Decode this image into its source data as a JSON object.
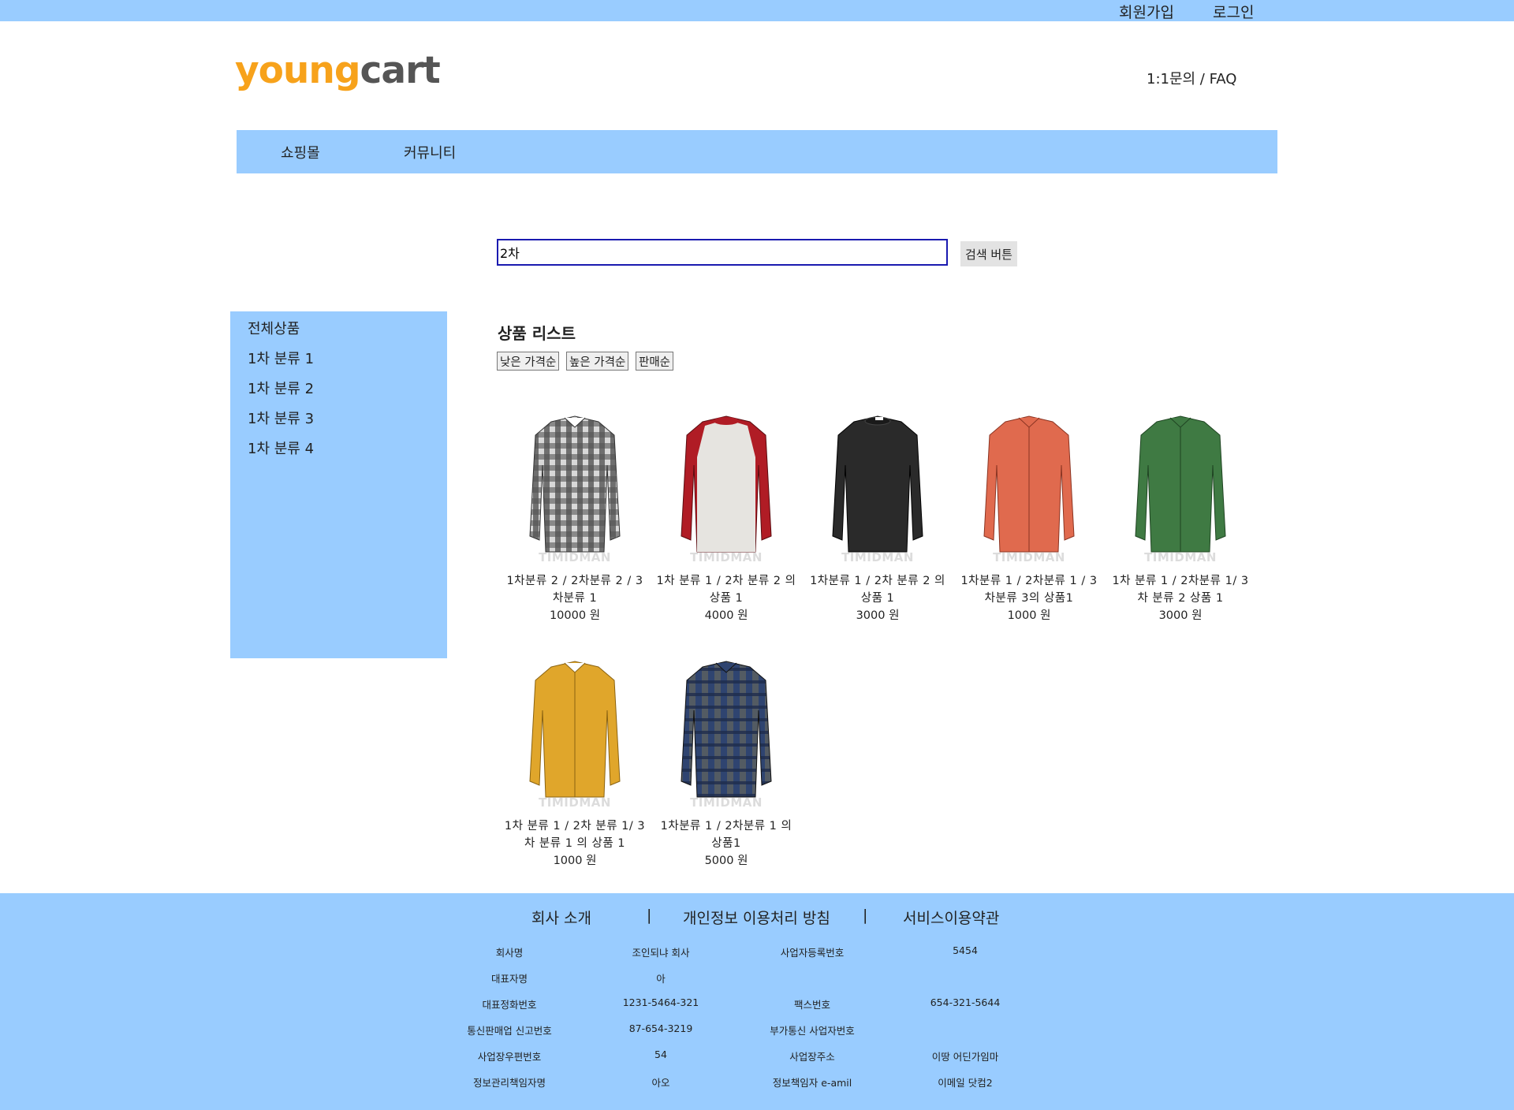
{
  "top_nav": {
    "signup": "회원가입",
    "login": "로그인"
  },
  "logo": {
    "part1": "young",
    "part2": "cart"
  },
  "header": {
    "help_links": "1:1문의 / FAQ"
  },
  "main_nav": [
    "쇼핑몰",
    "커뮤니티"
  ],
  "search": {
    "value": "2차",
    "button_label": "검색 버튼"
  },
  "sidebar": {
    "items": [
      "전체상품",
      "1차 분류 1",
      "1차 분류 2",
      "1차 분류 3",
      "1차 분류 4"
    ]
  },
  "product_list": {
    "title": "상품 리스트",
    "sort_buttons": [
      "낮은 가격순",
      "높은 가격순",
      "판매순"
    ],
    "watermark": "TIMIDMAN",
    "items": [
      {
        "name_line1": "1차분류 2 / 2차분류 2 / 3",
        "name_line2": "차분류 1",
        "price": "10000 원",
        "color": "plaid-gray"
      },
      {
        "name_line1": "1차 분류 1 / 2차 분류 2 의",
        "name_line2": "상품 1",
        "price": "4000 원",
        "color": "raglan-red"
      },
      {
        "name_line1": "1차분류 1 / 2차 분류 2 의",
        "name_line2": "상품 1",
        "price": "3000 원",
        "color": "black"
      },
      {
        "name_line1": "1차분류 1 / 2차분류 1 / 3",
        "name_line2": "차분류 3의 상품1",
        "price": "1000 원",
        "color": "coral"
      },
      {
        "name_line1": "1차 분류 1 / 2차분류 1/ 3",
        "name_line2": "차 분류 2 상품 1",
        "price": "3000 원",
        "color": "green"
      },
      {
        "name_line1": "1차 분류 1 / 2차 분류 1/ 3",
        "name_line2": "차 분류 1 의 상품 1",
        "price": "1000 원",
        "color": "mustard"
      },
      {
        "name_line1": "1차분류 1 / 2차분류 1 의",
        "name_line2": "상품1",
        "price": "5000 원",
        "color": "plaid-navy"
      }
    ]
  },
  "colors": {
    "accent": "#99ccff",
    "logo_orange": "#f7a21b",
    "logo_gray": "#555555",
    "search_border": "#1a1ab0",
    "shirt_colors": {
      "plaid-gray": "#6b6b6b",
      "raglan-red": "#b01c25",
      "black": "#2a2a2a",
      "coral": "#e06a4e",
      "green": "#3f7a43",
      "mustard": "#e0a62b",
      "plaid-navy": "#2f4470"
    }
  },
  "footer": {
    "links": [
      "회사 소개",
      "개인정보 이용처리 방침",
      "서비스이용약관"
    ],
    "separator": "|",
    "info_rows": [
      [
        "회사명",
        "조인되냐 회사",
        "사업자등록번호",
        "5454"
      ],
      [
        "대표자명",
        "아",
        "",
        ""
      ],
      [
        "대표정화번호",
        "1231-5464-321",
        "팩스번호",
        "654-321-5644"
      ],
      [
        "통신판매업 신고번호",
        "87-654-3219",
        "부가통신 사업자번호",
        ""
      ],
      [
        "사업장우편번호",
        "54",
        "사업장주소",
        "이땅 어딘가임마"
      ],
      [
        "정보관리책임자명",
        "아오",
        "정보책임자 e-amil",
        "이메일 닷컴2"
      ]
    ]
  }
}
